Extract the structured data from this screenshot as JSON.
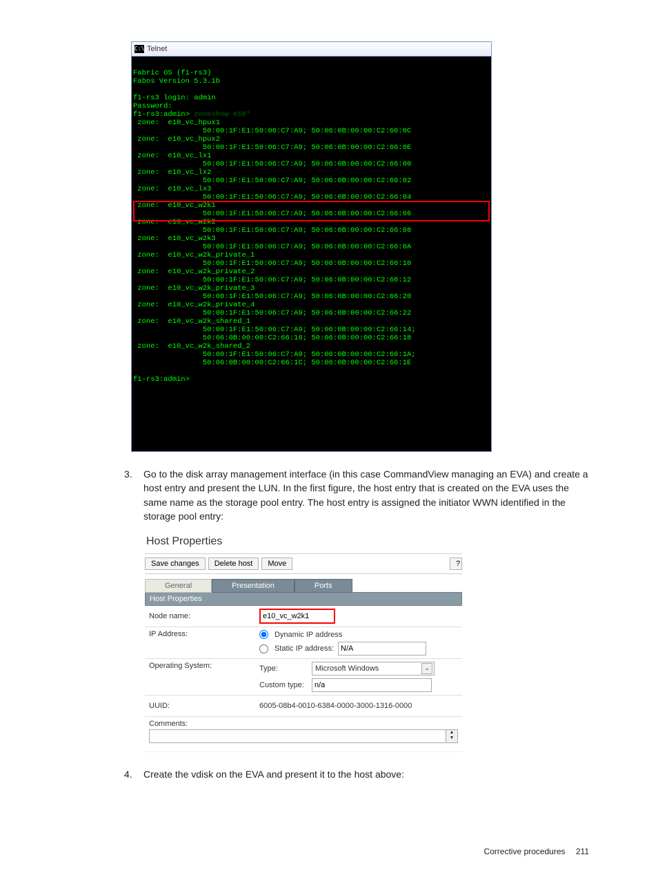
{
  "telnet": {
    "title": "Telnet",
    "cmd_icon_text": "C:\\",
    "header": "Fabric OS (f1-rs3)\nFabos Version 5.3.1b\n\n",
    "login_line": "f1-rs3 login: admin",
    "password_line": "Password:",
    "prompt_line_prefix": "f1-rs3:admin> ",
    "prompt_command_blurred": "zoneshow e10*",
    "zones": [
      {
        "name": "e10_vc_hpux1",
        "members": [
          "50:00:1F:E1:50:06:C7:A9; 50:06:0B:00:00:C2:66:0C"
        ]
      },
      {
        "name": "e10_vc_hpux2",
        "members": [
          "50:00:1F:E1:50:06:C7:A9; 50:06:0B:00:00:C2:66:0E"
        ]
      },
      {
        "name": "e10_vc_lx1",
        "members": [
          "50:00:1F:E1:50:06:C7:A9; 50:06:0B:00:00:C2:66:00"
        ]
      },
      {
        "name": "e10_vc_lx2",
        "members": [
          "50:00:1F:E1:50:06:C7:A9; 50:06:0B:00:00:C2:66:02"
        ]
      },
      {
        "name": "e10_vc_lx3",
        "members": [
          "50:00:1F:E1:50:06:C7:A9; 50:06:0B:00:00:C2:66:04"
        ]
      },
      {
        "name": "e10_vc_w2k1",
        "members": [
          "50:00:1F:E1:50:06:C7:A9; 50:06:0B:00:00:C2:66:06"
        ],
        "highlight": true
      },
      {
        "name": "e10_vc_w2k2",
        "members": [
          "50:00:1F:E1:50:06:C7:A9; 50:06:0B:00:00:C2:66:08"
        ]
      },
      {
        "name": "e10_vc_w2k3",
        "members": [
          "50:00:1F:E1:50:06:C7:A9; 50:06:0B:00:00:C2:66:0A"
        ]
      },
      {
        "name": "e10_vc_w2k_private_1",
        "members": [
          "50:00:1F:E1:50:06:C7:A9; 50:06:0B:00:00:C2:66:10"
        ]
      },
      {
        "name": "e10_vc_w2k_private_2",
        "members": [
          "50:00:1F:E1:50:06:C7:A9; 50:06:0B:00:00:C2:66:12"
        ]
      },
      {
        "name": "e10_vc_w2k_private_3",
        "members": [
          "50:00:1F:E1:50:06:C7:A9; 50:06:0B:00:00:C2:66:20"
        ]
      },
      {
        "name": "e10_vc_w2k_private_4",
        "members": [
          "50:00:1F:E1:50:06:C7:A9; 50:06:0B:00:00:C2:66:22"
        ]
      },
      {
        "name": "e10_vc_w2k_shared_1",
        "members": [
          "50:00:1F:E1:50:06:C7:A9; 50:06:0B:00:00:C2:66:14;",
          "50:06:0B:00:00:C2:66:16; 50:06:0B:00:00:C2:66:18"
        ]
      },
      {
        "name": "e10_vc_w2k_shared_2",
        "members": [
          "50:00:1F:E1:50:06:C7:A9; 50:06:0B:00:00:C2:66:1A;",
          "50:06:0B:00:00:C2:66:1C; 50:06:0B:00:00:C2:66:1E"
        ]
      }
    ],
    "final_prompt": "f1-rs3:admin>"
  },
  "step3": {
    "num": "3.",
    "text": "Go to the disk array management interface (in this case CommandView managing an EVA) and create a host entry and present the LUN. In the first figure, the host entry that is created on the EVA uses the same name as the storage pool entry. The host entry is assigned the initiator WWN identified in the storage pool entry:"
  },
  "hostprops": {
    "title": "Host Properties",
    "toolbar": {
      "save": "Save changes",
      "delete": "Delete host",
      "move": "Move",
      "help": "?"
    },
    "tabs": {
      "general": "General",
      "presentation": "Presentation",
      "ports": "Ports"
    },
    "section_header": "Host Properties",
    "node_name_label": "Node name:",
    "node_name_value": "e10_vc_w2k1",
    "ip_label": "IP Address:",
    "ip_dynamic_label": "Dynamic IP address",
    "ip_static_label": "Static IP address:",
    "ip_static_value": "N/A",
    "os_label": "Operating System:",
    "os_type_label": "Type:",
    "os_type_value": "Microsoft Windows",
    "os_custom_label": "Custom type:",
    "os_custom_value": "n/a",
    "uuid_label": "UUID:",
    "uuid_value": "6005-08b4-0010-6384-0000-3000-1316-0000",
    "comments_label": "Comments:"
  },
  "step4": {
    "num": "4.",
    "text": "Create the vdisk on the EVA and present it to the host above:"
  },
  "footer": {
    "section": "Corrective procedures",
    "page": "211"
  }
}
